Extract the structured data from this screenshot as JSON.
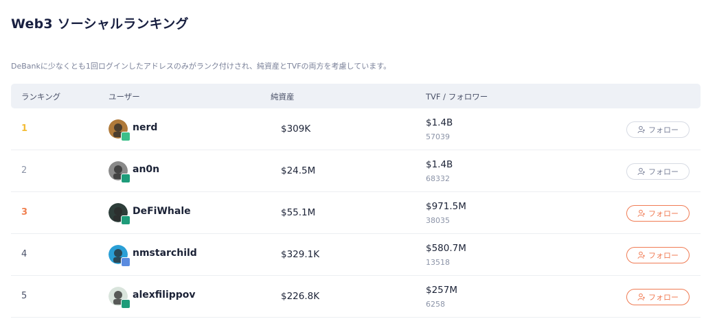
{
  "page": {
    "title": "Web3 ソーシャルランキング",
    "subtitle": "DeBankに少なくとも1回ログインしたアドレスのみがランク付けされ、純資産とTVFの両方を考慮しています。"
  },
  "table": {
    "headers": {
      "rank": "ランキング",
      "user": "ユーザー",
      "networth": "純資産",
      "tvf": "TVF / フォロワー"
    },
    "rows": [
      {
        "rank": "1",
        "name": "nerd",
        "networth": "$309K",
        "tvf": "$1.4B",
        "followers": "57039",
        "follow_label": "フォロー",
        "follow_state": "inactive",
        "avatar_color": "#b07a3a",
        "badge_color": "#3dbf8a"
      },
      {
        "rank": "2",
        "name": "an0n",
        "networth": "$24.5M",
        "tvf": "$1.4B",
        "followers": "68332",
        "follow_label": "フォロー",
        "follow_state": "inactive",
        "avatar_color": "#8a8a8a",
        "badge_color": "#1e9c7a"
      },
      {
        "rank": "3",
        "name": "DeFiWhale",
        "networth": "$55.1M",
        "tvf": "$971.5M",
        "followers": "38035",
        "follow_label": "フォロー",
        "follow_state": "active",
        "avatar_color": "#2e3e3a",
        "badge_color": "#1e9c7a"
      },
      {
        "rank": "4",
        "name": "nmstarchild",
        "networth": "$329.1K",
        "tvf": "$580.7M",
        "followers": "13518",
        "follow_label": "フォロー",
        "follow_state": "active",
        "avatar_color": "#2a9fd6",
        "badge_color": "#5a8be0"
      },
      {
        "rank": "5",
        "name": "alexfilippov",
        "networth": "$226.8K",
        "tvf": "$257M",
        "followers": "6258",
        "follow_label": "フォロー",
        "follow_state": "active",
        "avatar_color": "#d9e4dc",
        "badge_color": "#1e9c7a"
      }
    ]
  },
  "colors": {
    "gold": "#f3bc35",
    "silver": "#8b93a7",
    "bronze": "#f08050",
    "accent": "#f07a52"
  }
}
